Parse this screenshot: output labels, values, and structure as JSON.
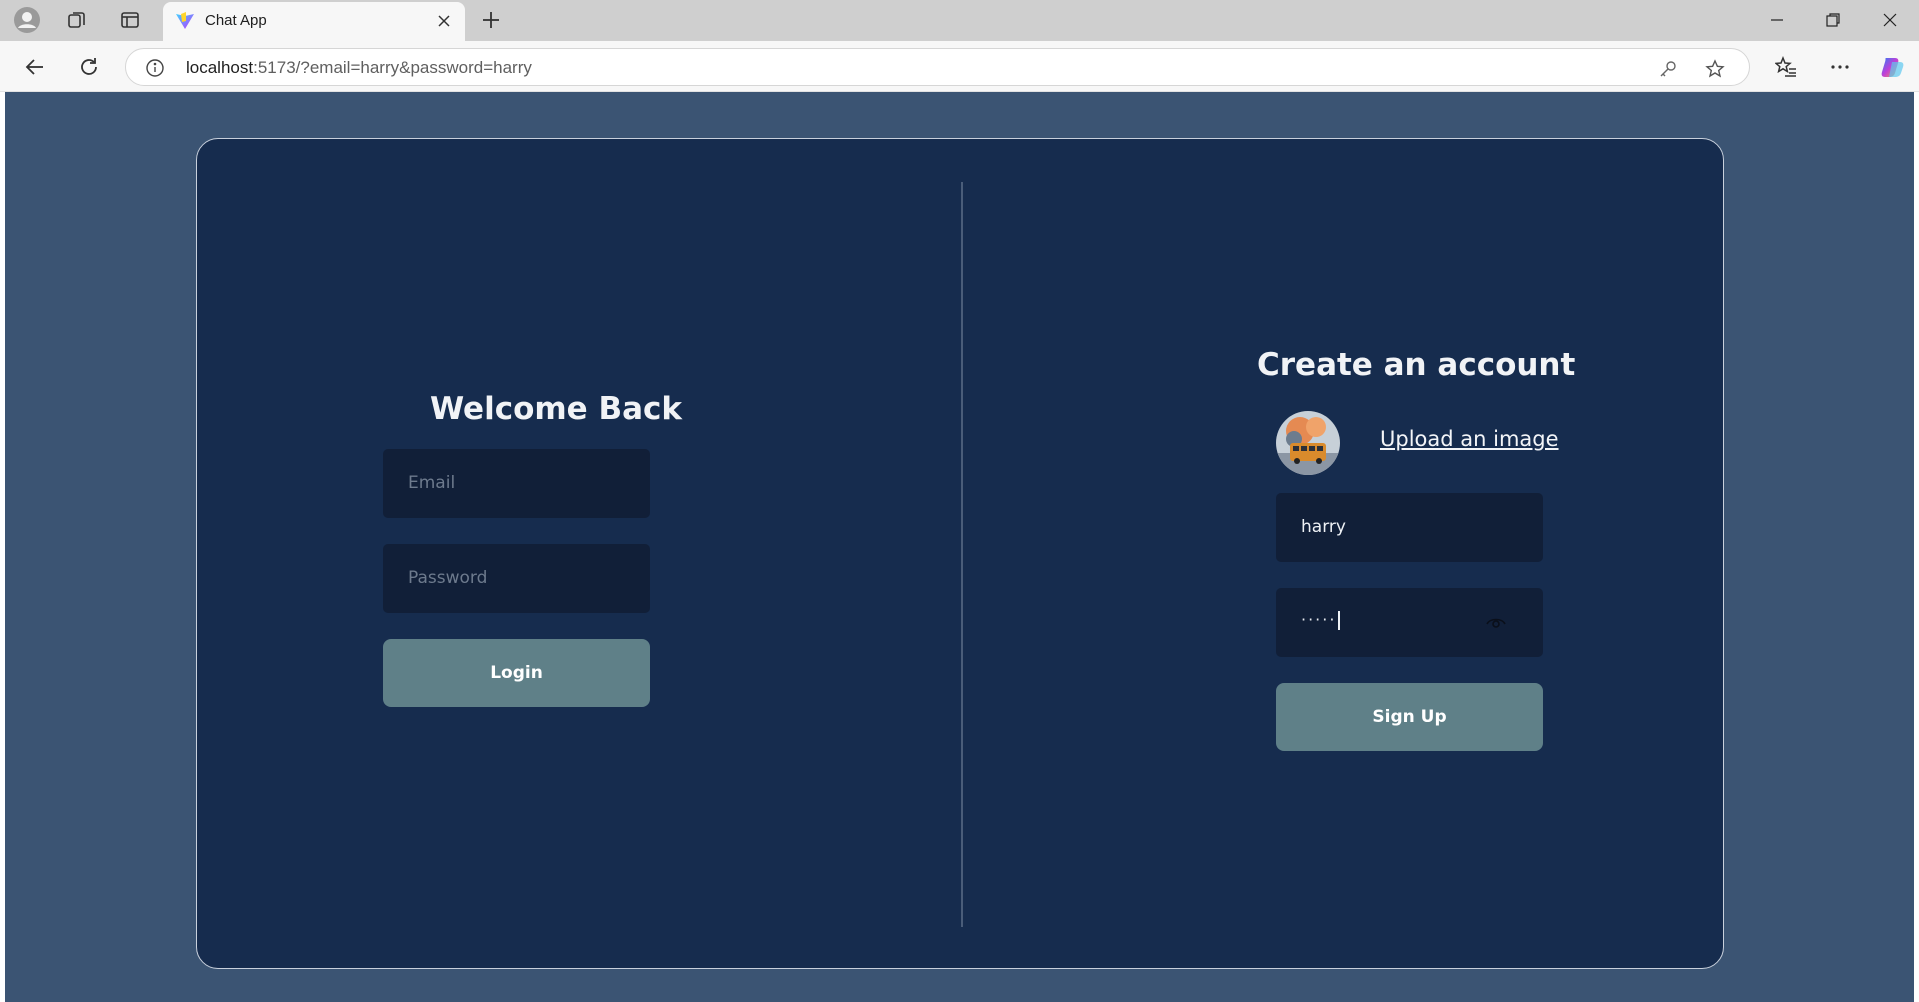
{
  "browser": {
    "tab_title": "Chat App",
    "url_host": "localhost",
    "url_rest": ":5173/?email=harry&password=harry",
    "icons": [
      "profile-icon",
      "workspaces-icon",
      "tab-actions-icon",
      "vite-favicon-icon",
      "close-tab-icon",
      "new-tab-icon",
      "minimize-icon",
      "restore-icon",
      "close-window-icon",
      "back-icon",
      "reload-icon",
      "site-info-icon",
      "password-key-icon",
      "favorite-star-icon",
      "favorites-list-icon",
      "more-icon",
      "copilot-icon"
    ]
  },
  "login": {
    "title": "Welcome Back",
    "email_placeholder": "Email",
    "password_placeholder": "Password",
    "button_label": "Login"
  },
  "signup": {
    "title": "Create an account",
    "upload_label": "Upload an image",
    "username_value": "harry",
    "password_mask": "·····",
    "button_label": "Sign Up"
  },
  "colors": {
    "page_bg": "#3b5473",
    "card_bg": "#162c4e",
    "field_bg": "#111f38",
    "button_bg": "#5f8088"
  }
}
